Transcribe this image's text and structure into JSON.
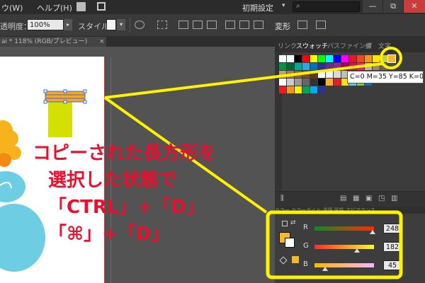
{
  "menubar": {
    "items": [
      "ウ(W)",
      "ヘルプ(H)"
    ],
    "preset": "初期設定",
    "preset_arrow": "▾",
    "search_icon": "⌕",
    "window_buttons": [
      "—",
      "⧉",
      "✕"
    ]
  },
  "ctrlbar": {
    "opacity_label": "透明度：",
    "opacity_value": "100%",
    "opacity_arrow": "▸",
    "style_label": "スタイル：",
    "style_arrow": "▾",
    "transform_label": "変形"
  },
  "document_tab": {
    "title": "ai * 118% (RGB/プレビュー)",
    "close_label": "×"
  },
  "swatch_panel": {
    "tabs": [
      "リンク",
      "スウォッチ",
      "パスファインダ",
      "線",
      "文字"
    ],
    "active_tab": "スウォッチ",
    "tooltip": "C=0 M=35 Y=85 K=0",
    "rows": [
      [
        "#ffffff",
        "#ffffff",
        "#000000",
        "#ff0000",
        "#ffff00",
        "#00ff00",
        "#00ffff",
        "#0000ff",
        "#ff00ff",
        "#e8142b",
        "#ea4b23",
        "#f7941d",
        "#ffe600",
        "#c6d82f",
        "#39b54a"
      ],
      [
        "#009245",
        "#006837",
        "#00a99d",
        "#29abe2",
        "#0071bc",
        "#2e3192",
        "#662d91",
        "#93278f",
        "#9e005d",
        "#d4145a",
        "#ed1e79",
        "#c7b299",
        "#998675",
        "#736357",
        "#534741"
      ],
      [
        "#c69c6d",
        "#a67c52",
        "#8c6239",
        "#754c24",
        "#603813",
        "#ffffff",
        "#f2f2f2",
        "#d9d9d9",
        "#bfbfbf",
        "#a6a6a6",
        "#8c8c8c",
        "#737373",
        "#595959",
        "#404040",
        "#262626"
      ],
      [
        "#ffffff",
        "#cccccc",
        "#999999",
        "#666666",
        "#333333",
        "#000000",
        "#fbb03b",
        "#ed1c24",
        "#ffde17",
        "#5ecde0",
        "#8cc63f",
        "#0f6fb7"
      ],
      [
        "#ed1c24",
        "#f7941d",
        "#fff200",
        "#00a651",
        "#00aeef",
        "#2e3192"
      ]
    ]
  },
  "color_panel": {
    "tabs": "カラー  カラーガイド  透明  属性  アピアランス",
    "fill_color": "#f8b62d",
    "channels": [
      {
        "label": "R",
        "value": "248",
        "fraction": 0.973
      },
      {
        "label": "G",
        "value": "182",
        "fraction": 0.714
      },
      {
        "label": "B",
        "value": "45",
        "fraction": 0.176
      }
    ]
  },
  "artwork": {
    "rect_color": "#d4e000",
    "selected_rect_color": "#f7a823",
    "cloud_color": "#6dcde2",
    "flower_color": "#f8b21c"
  },
  "annotation": {
    "color": "#e8102e",
    "line1": "コピーされた長方形を",
    "line2": "選択した状態で",
    "line3": "「CTRL」+「D」",
    "line4": "「⌘」+「D」",
    "highlight_color": "#fff200"
  }
}
